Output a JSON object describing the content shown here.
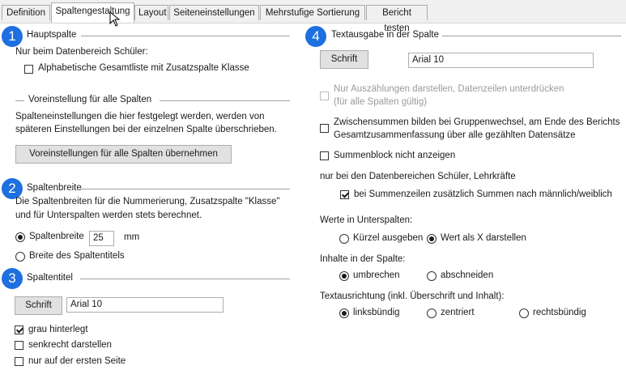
{
  "tabs": [
    "Definition",
    "Spaltengestaltung",
    "Layout",
    "Seiteneinstellungen",
    "Mehrstufige Sortierung",
    "Bericht testen"
  ],
  "section1": {
    "badge": "1",
    "title": "Hauptspalte",
    "intro": "Nur beim Datenbereich Schüler:",
    "checkbox_label": "Alphabetische Gesamtliste mit Zusatzspalte Klasse",
    "checkbox_checked": false
  },
  "defaults": {
    "title": "Voreinstellung für alle Spalten",
    "line1": "Spalteneinstellungen die hier festgelegt werden, werden von",
    "line2": "späteren Einstellungen bei der einzelnen Spalte überschrieben.",
    "button": "Voreinstellungen für alle Spalten übernehmen"
  },
  "section2": {
    "badge": "2",
    "title": "Spaltenbreite",
    "line1": "Die Spaltenbreiten für die Nummerierung, Zusatzspalte \"Klasse\"",
    "line2": "und für Unterspalten werden stets berechnet.",
    "radio_width_label": "Spaltenbreite",
    "width_value": "25",
    "width_unit": "mm",
    "radio_title_label": "Breite des Spaltentitels",
    "selected": "Spaltenbreite"
  },
  "section3": {
    "badge": "3",
    "title": "Spaltentitel",
    "font_button": "Schrift",
    "font_value": "Arial 10",
    "cb_gray": "grau hinterlegt",
    "cb_gray_checked": true,
    "cb_vertical": "senkrecht darstellen",
    "cb_vertical_checked": false,
    "cb_first_page": "nur auf der ersten Seite",
    "cb_first_page_checked": false
  },
  "section4": {
    "badge": "4",
    "title": "Textausgabe in der Spalte",
    "font_button": "Schrift",
    "font_value": "Arial 10",
    "cb_counts_line1": "Nur Auszählungen darstellen, Datenzeilen unterdrücken",
    "cb_counts_line2": "(für alle Spalten gültig)",
    "cb_counts_disabled": true,
    "cb_subtotals_line1": "Zwischensummen bilden bei Gruppenwechsel, am Ende des Berichts",
    "cb_subtotals_line2": "Gesamtzusammenfassung über alle gezählten Datensätze",
    "cb_subtotals_checked": false,
    "cb_sumblock": "Summenblock nicht anzeigen",
    "cb_sumblock_checked": false,
    "only_for": "nur bei den Datenbereichen Schüler, Lehrkräfte",
    "cb_gender": "bei Summenzeilen zusätzlich Summen nach männlich/weiblich",
    "cb_gender_checked": true,
    "sub_values_label": "Werte in Unterspalten:",
    "rb_short": "Kürzel ausgeben",
    "rb_x": "Wert als X darstellen",
    "sub_values_selected": "Wert als X darstellen",
    "content_label": "Inhalte in der Spalte:",
    "rb_wrap": "umbrechen",
    "rb_cut": "abschneiden",
    "content_selected": "umbrechen",
    "align_label": "Textausrichtung (inkl. Überschrift und Inhalt):",
    "rb_left": "linksbündig",
    "rb_center": "zentriert",
    "rb_right": "rechtsbündig",
    "align_selected": "linksbündig"
  },
  "colors": {
    "accent": "#1e6fe0",
    "button_bg": "#e1e1e1",
    "tab_bg": "#f0f0f0"
  }
}
